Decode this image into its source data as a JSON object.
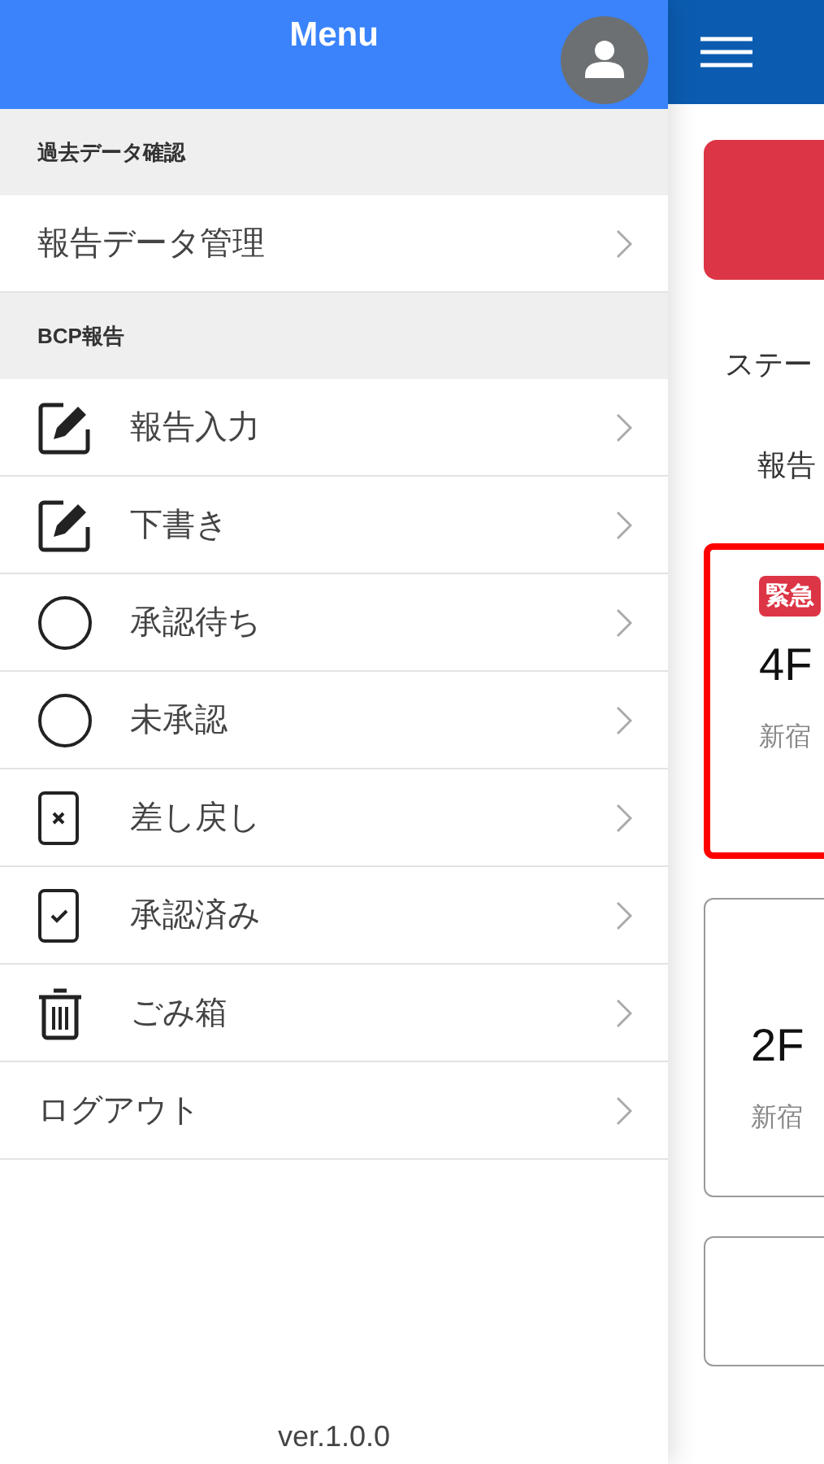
{
  "menu": {
    "title": "Menu",
    "sections": [
      {
        "heading": "過去データ確認",
        "items": [
          {
            "label": "報告データ管理",
            "kind": "plain"
          }
        ]
      },
      {
        "heading": "BCP報告",
        "items": [
          {
            "label": "報告入力",
            "kind": "edit"
          },
          {
            "label": "下書き",
            "kind": "edit"
          },
          {
            "label": "承認待ち",
            "kind": "circle"
          },
          {
            "label": "未承認",
            "kind": "circle"
          },
          {
            "label": "差し戻し",
            "kind": "cross-doc"
          },
          {
            "label": "承認済み",
            "kind": "check-doc"
          },
          {
            "label": "ごみ箱",
            "kind": "trash"
          },
          {
            "label": "ログアウト",
            "kind": "plain"
          }
        ]
      }
    ],
    "version": "ver.1.0.0"
  },
  "main": {
    "status_label": "ステー",
    "report_label": "報告",
    "cards": [
      {
        "badge": "緊急",
        "title": "4F",
        "place": "新宿",
        "urgent": true
      },
      {
        "title": "2F",
        "place": "新宿",
        "urgent": false
      }
    ]
  }
}
